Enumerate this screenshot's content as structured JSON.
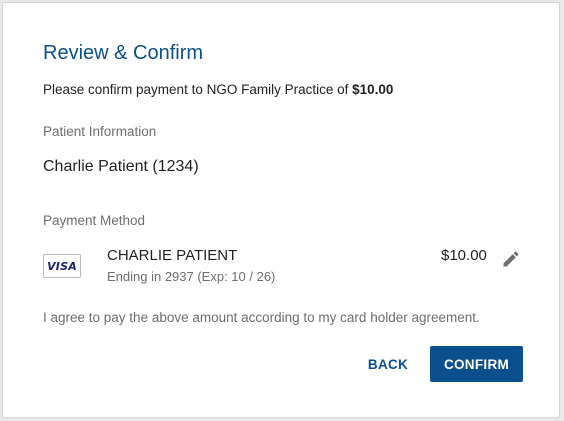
{
  "dialog": {
    "title": "Review & Confirm",
    "confirm_prefix": "Please confirm payment to NGO Family Practice of ",
    "confirm_amount": "$10.00"
  },
  "patient": {
    "section_label": "Patient Information",
    "name": "Charlie Patient (1234)"
  },
  "payment": {
    "section_label": "Payment Method",
    "card_brand": "VISA",
    "card_holder": "CHARLIE PATIENT",
    "card_detail": "Ending in 2937 (Exp: 10 / 26)",
    "amount": "$10.00",
    "edit_icon": "pencil-icon"
  },
  "agreement": "I agree to pay the above amount according to my card holder agreement.",
  "actions": {
    "back_label": "BACK",
    "confirm_label": "CONFIRM"
  },
  "colors": {
    "accent": "#0b4f8d",
    "visa": "#1a1f71"
  }
}
